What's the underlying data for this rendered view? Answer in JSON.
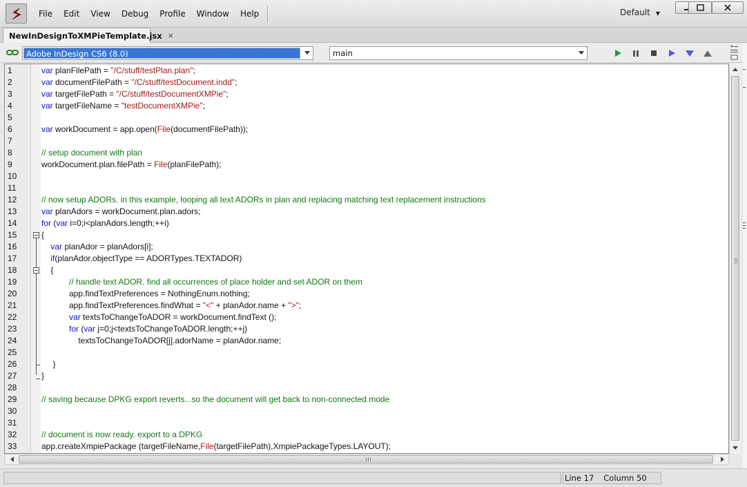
{
  "menu": [
    "File",
    "Edit",
    "View",
    "Debug",
    "Profile",
    "Window",
    "Help"
  ],
  "workspace": "Default",
  "tab": {
    "label": "NewInDesignToXMPieTemplate.jsx",
    "close": "×"
  },
  "toolbar": {
    "target": "Adobe InDesign CS6 (8.0)",
    "function": "main"
  },
  "icons": {
    "app_logo": "extendscript-logo-icon",
    "link": "link-icon",
    "run": "play-icon",
    "pause": "pause-icon",
    "stop": "stop-icon",
    "step_over": "step-over-icon",
    "step_into": "step-into-icon",
    "step_out": "step-out-icon"
  },
  "colors": {
    "keyword": "#1010c8",
    "string": "#a01818",
    "comment": "#117711",
    "builtin": "#b01010",
    "selection": "#3875d7"
  },
  "code_lines": [
    [
      {
        "t": "var",
        "c": "k"
      },
      {
        "t": " planFilePath = "
      },
      {
        "t": "\"/C/stuff/testPlan.plan\"",
        "c": "s"
      },
      {
        "t": ";"
      }
    ],
    [
      {
        "t": "var",
        "c": "k"
      },
      {
        "t": " documentFilePath = "
      },
      {
        "t": "\"/C/stuff/testDocument.indd\"",
        "c": "s"
      },
      {
        "t": ";"
      }
    ],
    [
      {
        "t": "var",
        "c": "k"
      },
      {
        "t": " targetFilePath = "
      },
      {
        "t": "\"/C/stuff/testDocumentXMPie\"",
        "c": "s"
      },
      {
        "t": ";"
      }
    ],
    [
      {
        "t": "var",
        "c": "k"
      },
      {
        "t": " targetFileName = "
      },
      {
        "t": "\"testDocumentXMPie\"",
        "c": "s"
      },
      {
        "t": ";"
      }
    ],
    [],
    [
      {
        "t": "var",
        "c": "k"
      },
      {
        "t": " workDocument = app.open("
      },
      {
        "t": "File",
        "c": "f"
      },
      {
        "t": "(documentFilePath));"
      }
    ],
    [],
    [
      {
        "t": "// setup document with plan",
        "c": "c"
      }
    ],
    [
      {
        "t": "workDocument.plan.filePath = "
      },
      {
        "t": "File",
        "c": "f"
      },
      {
        "t": "(planFilePath);"
      }
    ],
    [],
    [],
    [
      {
        "t": "// now setup ADORs. in this example, looping all text ADORs in plan and replacing matching text replacement instructions",
        "c": "c"
      }
    ],
    [
      {
        "t": "var",
        "c": "k"
      },
      {
        "t": " planAdors = workDocument.plan.adors;"
      }
    ],
    [
      {
        "t": "for",
        "c": "k"
      },
      {
        "t": " ("
      },
      {
        "t": "var",
        "c": "k"
      },
      {
        "t": " i=0;i<planAdors.length;++i)"
      }
    ],
    [
      {
        "t": "{"
      }
    ],
    [
      {
        "t": "    "
      },
      {
        "t": "var",
        "c": "k"
      },
      {
        "t": " planAdor = planAdors[i];"
      }
    ],
    [
      {
        "t": "    "
      },
      {
        "t": "if",
        "c": "k"
      },
      {
        "t": "(planAdor.objectType == ADORTypes.TEXTADOR)"
      }
    ],
    [
      {
        "t": "    {"
      }
    ],
    [
      {
        "t": "            "
      },
      {
        "t": "// handle text ADOR. find all occurrences of place holder and set ADOR on them",
        "c": "c"
      }
    ],
    [
      {
        "t": "            app.findTextPreferences = NothingEnum.nothing;"
      }
    ],
    [
      {
        "t": "            app.findTextPreferences.findWhat = "
      },
      {
        "t": "\"<\"",
        "c": "s"
      },
      {
        "t": " + planAdor.name + "
      },
      {
        "t": "\">\"",
        "c": "s"
      },
      {
        "t": ";"
      }
    ],
    [
      {
        "t": "            "
      },
      {
        "t": "var",
        "c": "k"
      },
      {
        "t": " textsToChangeToADOR = workDocument.findText ();"
      }
    ],
    [
      {
        "t": "            "
      },
      {
        "t": "for",
        "c": "k"
      },
      {
        "t": " ("
      },
      {
        "t": "var",
        "c": "k"
      },
      {
        "t": " j=0;j<textsToChangeToADOR.length;++j)"
      }
    ],
    [
      {
        "t": "                textsToChangeToADOR[j].adorName = planAdor.name;"
      }
    ],
    [],
    [
      {
        "t": "     }"
      }
    ],
    [
      {
        "t": "}"
      }
    ],
    [],
    [
      {
        "t": "// saving because DPKG export reverts...so the document will get back to non-connected mode",
        "c": "c"
      }
    ],
    [],
    [],
    [
      {
        "t": "// document is now ready. export to a DPKG",
        "c": "c"
      }
    ],
    [
      {
        "t": "app.createXmpiePackage (targetFileName,"
      },
      {
        "t": "File",
        "c": "f"
      },
      {
        "t": "(targetFilePath),XmpiePackageTypes.LAYOUT);"
      }
    ]
  ],
  "line_numbers": [
    "1",
    "2",
    "3",
    "4",
    "5",
    "6",
    "7",
    "8",
    "9",
    "10",
    "11",
    "12",
    "13",
    "14",
    "15",
    "16",
    "17",
    "18",
    "19",
    "20",
    "21",
    "22",
    "23",
    "24",
    "25",
    "26",
    "27",
    "28",
    "29",
    "30",
    "31",
    "32",
    "33"
  ],
  "status": {
    "message": "",
    "line": "Line 17",
    "column": "Column 50"
  }
}
